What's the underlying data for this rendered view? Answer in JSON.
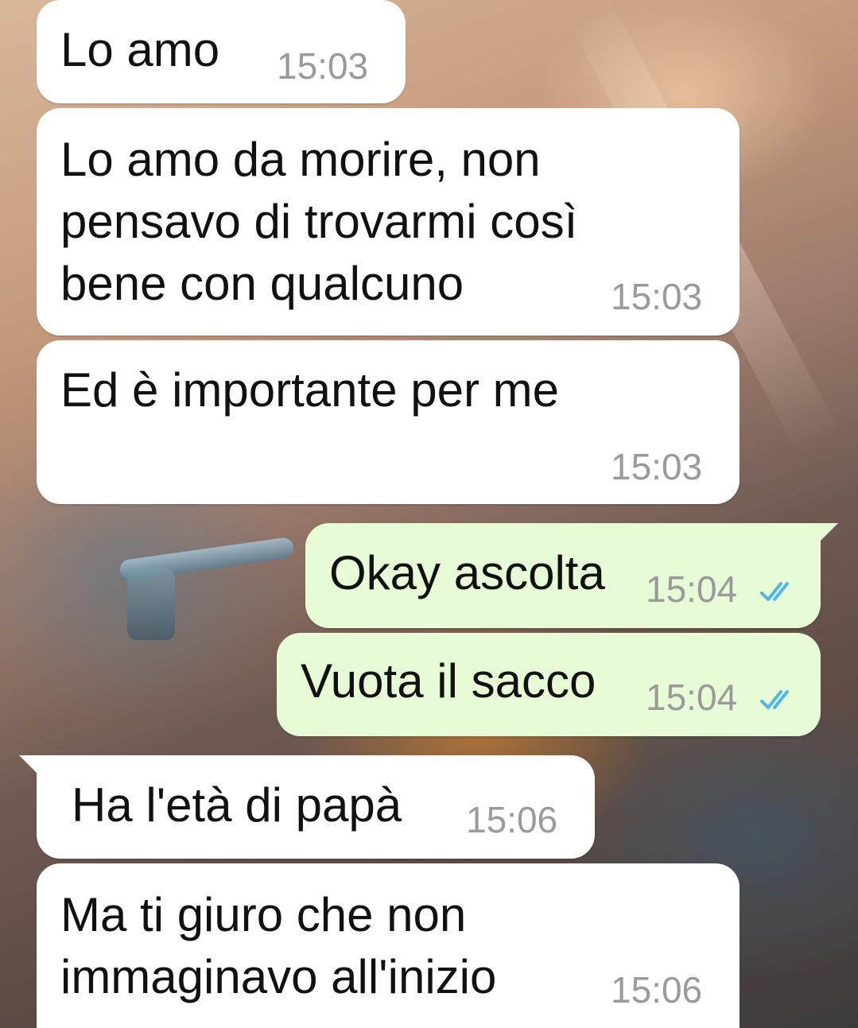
{
  "messages": [
    {
      "direction": "incoming",
      "text": "Lo amo",
      "time": "15:03"
    },
    {
      "direction": "incoming",
      "text": "Lo amo da morire, non\npensavo di trovarmi così\nbene con qualcuno",
      "time": "15:03"
    },
    {
      "direction": "incoming",
      "text": "Ed è importante per me",
      "time": "15:03"
    },
    {
      "direction": "outgoing",
      "text": "Okay ascolta",
      "time": "15:04",
      "status": "read"
    },
    {
      "direction": "outgoing",
      "text": "Vuota il sacco",
      "time": "15:04",
      "status": "read"
    },
    {
      "direction": "incoming",
      "text": "Ha l'età di papà",
      "time": "15:06"
    },
    {
      "direction": "incoming",
      "text": "Ma ti giuro che non\nimmaginavo all'inizio",
      "time": "15:06"
    }
  ],
  "colors": {
    "incoming_bubble": "#ffffff",
    "outgoing_bubble": "#e7fcd6",
    "timestamp": "#9a9a9a",
    "read_ticks": "#4fb6ec"
  },
  "icons": {
    "read_status": "double-check-icon"
  }
}
